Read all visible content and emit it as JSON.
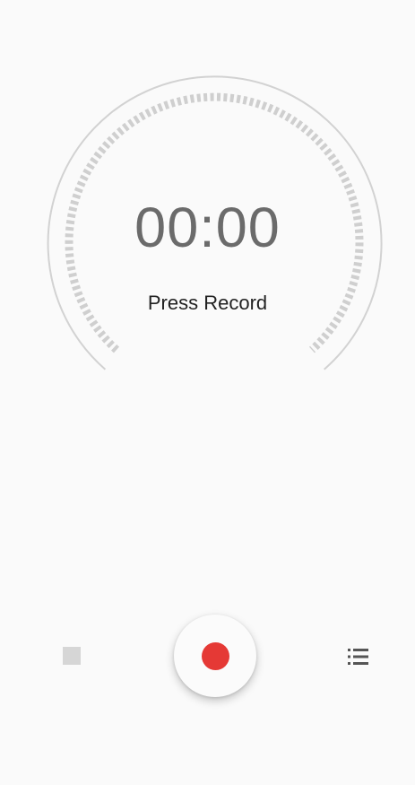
{
  "timer": {
    "elapsed": "00:00"
  },
  "status": {
    "text": "Press Record"
  },
  "controls": {
    "stop_icon": "stop-square-icon",
    "record_icon": "record-dot-icon",
    "list_icon": "list-icon"
  },
  "colors": {
    "record": "#e53935",
    "dial": "#d0d0d0",
    "ticks": "#cfcfcf",
    "timer_text": "#6b6b6b",
    "background": "#fafafa"
  }
}
